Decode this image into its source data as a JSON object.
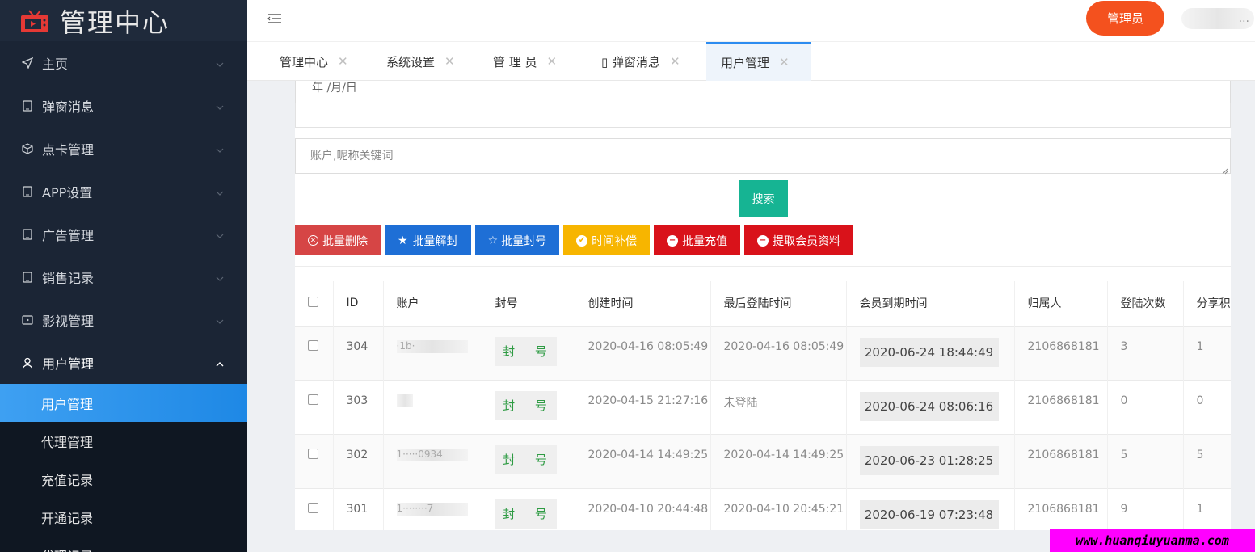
{
  "brand": {
    "title": "管理中心"
  },
  "sidebar": {
    "items": [
      {
        "label": "主页",
        "icon": "send-icon"
      },
      {
        "label": "弹窗消息",
        "icon": "tablet-icon"
      },
      {
        "label": "点卡管理",
        "icon": "cube-icon"
      },
      {
        "label": "APP设置",
        "icon": "tablet-icon"
      },
      {
        "label": "广告管理",
        "icon": "tablet-icon"
      },
      {
        "label": "销售记录",
        "icon": "tablet-icon"
      },
      {
        "label": "影视管理",
        "icon": "play-icon"
      },
      {
        "label": "用户管理",
        "icon": "user-icon"
      }
    ],
    "sub_items": [
      {
        "label": "用户管理",
        "active": true
      },
      {
        "label": "代理管理"
      },
      {
        "label": "充值记录"
      },
      {
        "label": "开通记录"
      },
      {
        "label": "代理记录"
      }
    ]
  },
  "header": {
    "admin_label": "管理员",
    "user_blur": "..."
  },
  "tabs": [
    {
      "label": "管理中心"
    },
    {
      "label": "系统设置"
    },
    {
      "label": "管 理 员"
    },
    {
      "label": "▯ 弹窗消息"
    },
    {
      "label": "用户管理",
      "active": true
    }
  ],
  "filters": {
    "date_placeholder": "年 /月/日",
    "keyword_placeholder": "账户,昵称关键词",
    "search_label": "搜索"
  },
  "toolbar": [
    {
      "label": "批量删除",
      "icon": "circle-x-icon",
      "color": "#d64545"
    },
    {
      "label": "批量解封",
      "icon": "star-icon",
      "color": "#1e6fd6"
    },
    {
      "label": "批量封号",
      "icon": "star-outline-icon",
      "color": "#1e6fd6"
    },
    {
      "label": "时间补偿",
      "icon": "check-circle-icon",
      "color": "#f7b500"
    },
    {
      "label": "批量充值",
      "icon": "minus-circle-icon",
      "color": "#d9121a"
    },
    {
      "label": "提取会员资料",
      "icon": "minus-circle-icon",
      "color": "#d9121a"
    }
  ],
  "table": {
    "headers": [
      "ID",
      "账户",
      "封号",
      "创建时间",
      "最后登陆时间",
      "会员到期时间",
      "归属人",
      "登陆次数",
      "分享积"
    ],
    "ban_label": "封 号",
    "rows": [
      {
        "id": "304",
        "account": "·1b·",
        "created": "2020-04-16 08:05:49",
        "last_login": "2020-04-16 08:05:49",
        "expiry": "2020-06-24 18:44:49",
        "owner": "2106868181",
        "logins": "3",
        "share": "1"
      },
      {
        "id": "303",
        "account": "",
        "created": "2020-04-15 21:27:16",
        "last_login": "未登陆",
        "expiry": "2020-06-24 08:06:16",
        "owner": "2106868181",
        "logins": "0",
        "share": "0"
      },
      {
        "id": "302",
        "account": "1·····0934",
        "created": "2020-04-14 14:49:25",
        "last_login": "2020-04-14 14:49:25",
        "expiry": "2020-06-23 01:28:25",
        "owner": "2106868181",
        "logins": "5",
        "share": "5"
      },
      {
        "id": "301",
        "account": "1········7",
        "created": "2020-04-10 20:44:48",
        "last_login": "2020-04-10 20:45:21",
        "expiry": "2020-06-19 07:23:48",
        "owner": "2106868181",
        "logins": "9",
        "share": "1"
      }
    ]
  },
  "watermark": "www.huanqiuyuanma.com"
}
